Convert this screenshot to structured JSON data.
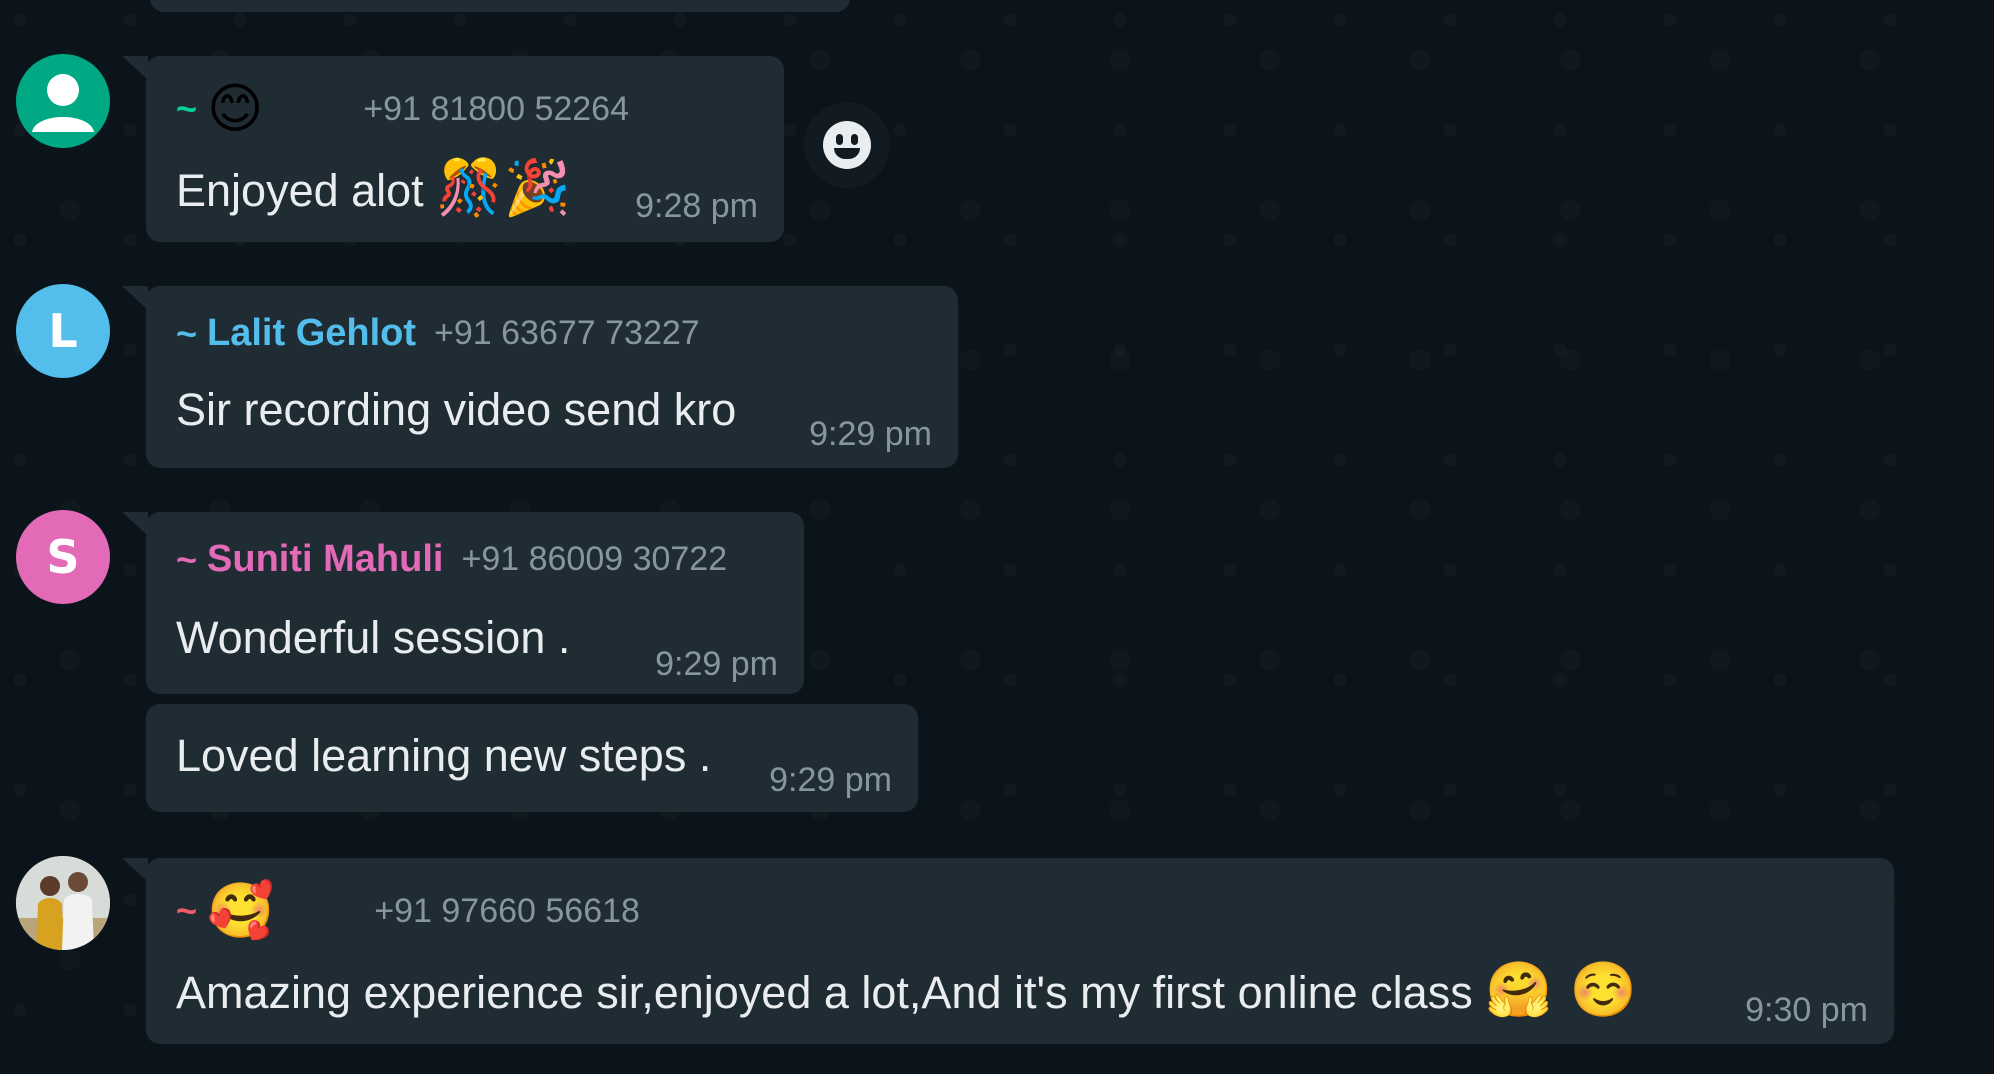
{
  "colors": {
    "background": "#0b141a",
    "bubble": "#202c33",
    "text": "#e9edef",
    "meta": "#8696a0"
  },
  "messages": [
    {
      "avatar": {
        "icon": "default-user-icon",
        "color": "#00a884"
      },
      "sender_tilde": "~",
      "sender_name": "",
      "sender_emoji": "😊",
      "sender_color": "#06cf9c",
      "phone": "+91 81800 52264",
      "text": "Enjoyed alot",
      "text_emoji": "🎊🎉",
      "time": "9:28 pm"
    },
    {
      "avatar": {
        "letter": "L",
        "color": "#53bdeb"
      },
      "sender_tilde": "~",
      "sender_name": "Lalit Gehlot",
      "sender_color": "#53bdeb",
      "phone": "+91 63677 73227",
      "text": "Sir recording video send kro",
      "time": "9:29 pm"
    },
    {
      "avatar": {
        "letter": "S",
        "color": "#e26ab6"
      },
      "sender_tilde": "~",
      "sender_name": "Suniti Mahuli",
      "sender_color": "#e26ab6",
      "phone": "+91 86009 30722",
      "text": "Wonderful session .",
      "time": "9:29 pm"
    },
    {
      "text": "Loved learning new steps .",
      "time": "9:29 pm"
    },
    {
      "avatar": {
        "icon": "profile-photo-icon",
        "color": "#9aa7b0"
      },
      "sender_tilde": "~",
      "sender_name": "",
      "sender_emoji": "🥰",
      "sender_color": "#f15c6d",
      "phone": "+91 97660 56618",
      "text": "Amazing experience sir,enjoyed a lot,And it's my first online class",
      "text_emoji": "🤗 ☺️",
      "time": "9:30 pm"
    }
  ],
  "react_button": {
    "icon": "emoji-react-icon"
  }
}
